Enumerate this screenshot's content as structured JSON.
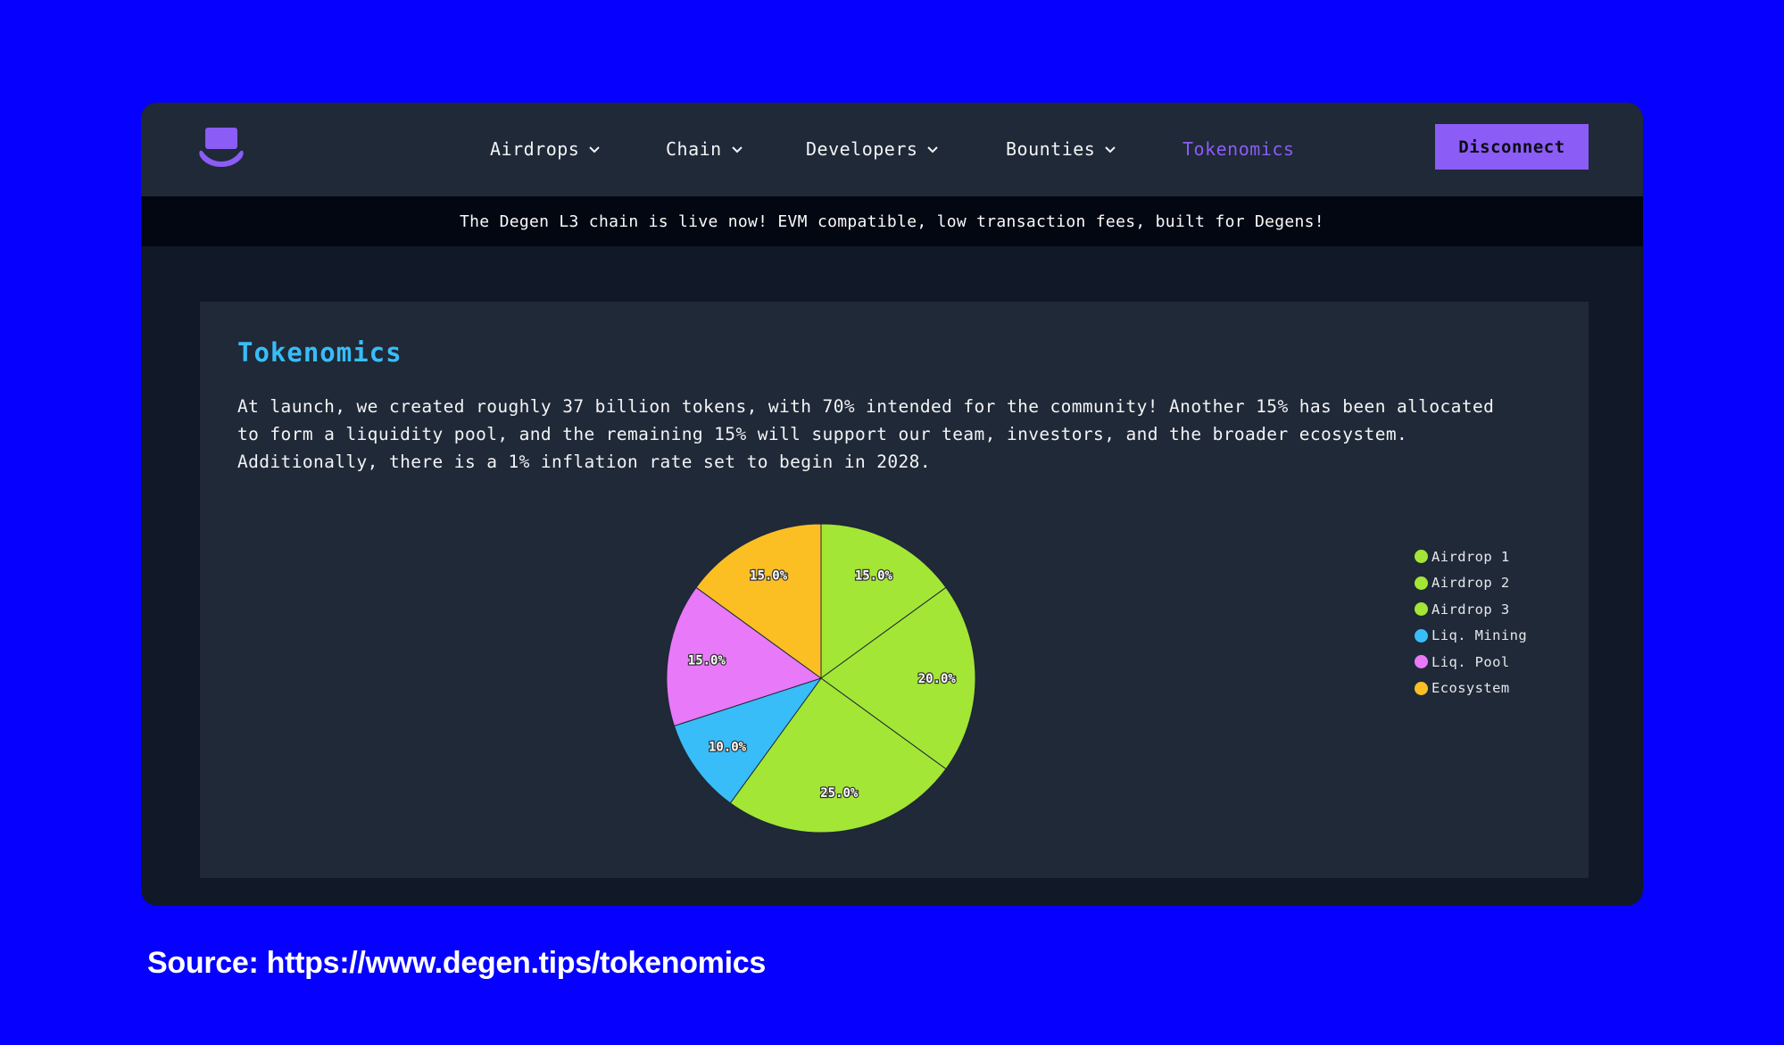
{
  "nav": {
    "items": [
      {
        "label": "Airdrops",
        "has_dropdown": true
      },
      {
        "label": "Chain",
        "has_dropdown": true
      },
      {
        "label": "Developers",
        "has_dropdown": true
      },
      {
        "label": "Bounties",
        "has_dropdown": true
      },
      {
        "label": "Tokenomics",
        "has_dropdown": false,
        "active": true
      }
    ],
    "disconnect_label": "Disconnect",
    "logo_icon": "top-hat-icon"
  },
  "banner": {
    "text": "The Degen L3 chain is live now! EVM compatible, low transaction fees, built for Degens!"
  },
  "main": {
    "title": "Tokenomics",
    "description": "At launch, we created roughly 37 billion tokens, with 70% intended for the community! Another 15% has been allocated to form a liquidity pool, and the remaining 15% will support our team, investors, and the broader ecosystem. Additionally, there is a 1% inflation rate set to begin in 2028."
  },
  "colors": {
    "page_background": "#0600ff",
    "accent": "#8b5cf6",
    "title": "#38bdf8",
    "airdrop": "#a3e635",
    "liq_mining": "#38bdf8",
    "liq_pool": "#e879f9",
    "ecosystem": "#fbbf24"
  },
  "chart_data": {
    "type": "pie",
    "categories": [
      "Airdrop 1",
      "Airdrop 2",
      "Airdrop 3",
      "Liq. Mining",
      "Liq. Pool",
      "Ecosystem"
    ],
    "values": [
      15.0,
      20.0,
      25.0,
      10.0,
      15.0,
      15.0
    ],
    "labels": [
      "15.0%",
      "20.0%",
      "25.0%",
      "10.0%",
      "15.0%",
      "15.0%"
    ],
    "colors": [
      "#a3e635",
      "#a3e635",
      "#a3e635",
      "#38bdf8",
      "#e879f9",
      "#fbbf24"
    ],
    "legend_position": "right",
    "title": ""
  },
  "footer": {
    "source": "Source: https://www.degen.tips/tokenomics"
  }
}
